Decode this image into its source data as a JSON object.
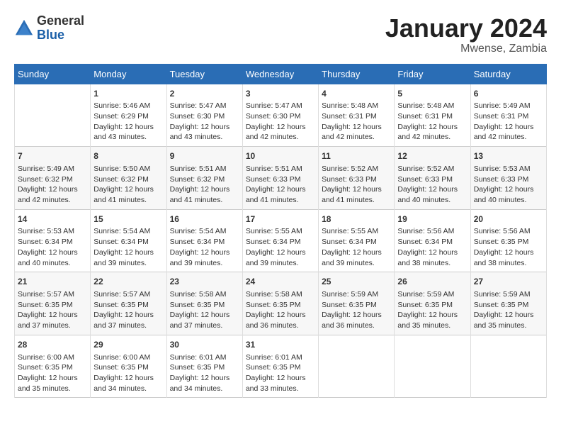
{
  "header": {
    "logo_general": "General",
    "logo_blue": "Blue",
    "month_title": "January 2024",
    "location": "Mwense, Zambia"
  },
  "days_of_week": [
    "Sunday",
    "Monday",
    "Tuesday",
    "Wednesday",
    "Thursday",
    "Friday",
    "Saturday"
  ],
  "weeks": [
    [
      {
        "day": "",
        "sunrise": "",
        "sunset": "",
        "daylight": ""
      },
      {
        "day": "1",
        "sunrise": "Sunrise: 5:46 AM",
        "sunset": "Sunset: 6:29 PM",
        "daylight": "Daylight: 12 hours and 43 minutes."
      },
      {
        "day": "2",
        "sunrise": "Sunrise: 5:47 AM",
        "sunset": "Sunset: 6:30 PM",
        "daylight": "Daylight: 12 hours and 43 minutes."
      },
      {
        "day": "3",
        "sunrise": "Sunrise: 5:47 AM",
        "sunset": "Sunset: 6:30 PM",
        "daylight": "Daylight: 12 hours and 42 minutes."
      },
      {
        "day": "4",
        "sunrise": "Sunrise: 5:48 AM",
        "sunset": "Sunset: 6:31 PM",
        "daylight": "Daylight: 12 hours and 42 minutes."
      },
      {
        "day": "5",
        "sunrise": "Sunrise: 5:48 AM",
        "sunset": "Sunset: 6:31 PM",
        "daylight": "Daylight: 12 hours and 42 minutes."
      },
      {
        "day": "6",
        "sunrise": "Sunrise: 5:49 AM",
        "sunset": "Sunset: 6:31 PM",
        "daylight": "Daylight: 12 hours and 42 minutes."
      }
    ],
    [
      {
        "day": "7",
        "sunrise": "Sunrise: 5:49 AM",
        "sunset": "Sunset: 6:32 PM",
        "daylight": "Daylight: 12 hours and 42 minutes."
      },
      {
        "day": "8",
        "sunrise": "Sunrise: 5:50 AM",
        "sunset": "Sunset: 6:32 PM",
        "daylight": "Daylight: 12 hours and 41 minutes."
      },
      {
        "day": "9",
        "sunrise": "Sunrise: 5:51 AM",
        "sunset": "Sunset: 6:32 PM",
        "daylight": "Daylight: 12 hours and 41 minutes."
      },
      {
        "day": "10",
        "sunrise": "Sunrise: 5:51 AM",
        "sunset": "Sunset: 6:33 PM",
        "daylight": "Daylight: 12 hours and 41 minutes."
      },
      {
        "day": "11",
        "sunrise": "Sunrise: 5:52 AM",
        "sunset": "Sunset: 6:33 PM",
        "daylight": "Daylight: 12 hours and 41 minutes."
      },
      {
        "day": "12",
        "sunrise": "Sunrise: 5:52 AM",
        "sunset": "Sunset: 6:33 PM",
        "daylight": "Daylight: 12 hours and 40 minutes."
      },
      {
        "day": "13",
        "sunrise": "Sunrise: 5:53 AM",
        "sunset": "Sunset: 6:33 PM",
        "daylight": "Daylight: 12 hours and 40 minutes."
      }
    ],
    [
      {
        "day": "14",
        "sunrise": "Sunrise: 5:53 AM",
        "sunset": "Sunset: 6:34 PM",
        "daylight": "Daylight: 12 hours and 40 minutes."
      },
      {
        "day": "15",
        "sunrise": "Sunrise: 5:54 AM",
        "sunset": "Sunset: 6:34 PM",
        "daylight": "Daylight: 12 hours and 39 minutes."
      },
      {
        "day": "16",
        "sunrise": "Sunrise: 5:54 AM",
        "sunset": "Sunset: 6:34 PM",
        "daylight": "Daylight: 12 hours and 39 minutes."
      },
      {
        "day": "17",
        "sunrise": "Sunrise: 5:55 AM",
        "sunset": "Sunset: 6:34 PM",
        "daylight": "Daylight: 12 hours and 39 minutes."
      },
      {
        "day": "18",
        "sunrise": "Sunrise: 5:55 AM",
        "sunset": "Sunset: 6:34 PM",
        "daylight": "Daylight: 12 hours and 39 minutes."
      },
      {
        "day": "19",
        "sunrise": "Sunrise: 5:56 AM",
        "sunset": "Sunset: 6:34 PM",
        "daylight": "Daylight: 12 hours and 38 minutes."
      },
      {
        "day": "20",
        "sunrise": "Sunrise: 5:56 AM",
        "sunset": "Sunset: 6:35 PM",
        "daylight": "Daylight: 12 hours and 38 minutes."
      }
    ],
    [
      {
        "day": "21",
        "sunrise": "Sunrise: 5:57 AM",
        "sunset": "Sunset: 6:35 PM",
        "daylight": "Daylight: 12 hours and 37 minutes."
      },
      {
        "day": "22",
        "sunrise": "Sunrise: 5:57 AM",
        "sunset": "Sunset: 6:35 PM",
        "daylight": "Daylight: 12 hours and 37 minutes."
      },
      {
        "day": "23",
        "sunrise": "Sunrise: 5:58 AM",
        "sunset": "Sunset: 6:35 PM",
        "daylight": "Daylight: 12 hours and 37 minutes."
      },
      {
        "day": "24",
        "sunrise": "Sunrise: 5:58 AM",
        "sunset": "Sunset: 6:35 PM",
        "daylight": "Daylight: 12 hours and 36 minutes."
      },
      {
        "day": "25",
        "sunrise": "Sunrise: 5:59 AM",
        "sunset": "Sunset: 6:35 PM",
        "daylight": "Daylight: 12 hours and 36 minutes."
      },
      {
        "day": "26",
        "sunrise": "Sunrise: 5:59 AM",
        "sunset": "Sunset: 6:35 PM",
        "daylight": "Daylight: 12 hours and 35 minutes."
      },
      {
        "day": "27",
        "sunrise": "Sunrise: 5:59 AM",
        "sunset": "Sunset: 6:35 PM",
        "daylight": "Daylight: 12 hours and 35 minutes."
      }
    ],
    [
      {
        "day": "28",
        "sunrise": "Sunrise: 6:00 AM",
        "sunset": "Sunset: 6:35 PM",
        "daylight": "Daylight: 12 hours and 35 minutes."
      },
      {
        "day": "29",
        "sunrise": "Sunrise: 6:00 AM",
        "sunset": "Sunset: 6:35 PM",
        "daylight": "Daylight: 12 hours and 34 minutes."
      },
      {
        "day": "30",
        "sunrise": "Sunrise: 6:01 AM",
        "sunset": "Sunset: 6:35 PM",
        "daylight": "Daylight: 12 hours and 34 minutes."
      },
      {
        "day": "31",
        "sunrise": "Sunrise: 6:01 AM",
        "sunset": "Sunset: 6:35 PM",
        "daylight": "Daylight: 12 hours and 33 minutes."
      },
      {
        "day": "",
        "sunrise": "",
        "sunset": "",
        "daylight": ""
      },
      {
        "day": "",
        "sunrise": "",
        "sunset": "",
        "daylight": ""
      },
      {
        "day": "",
        "sunrise": "",
        "sunset": "",
        "daylight": ""
      }
    ]
  ]
}
